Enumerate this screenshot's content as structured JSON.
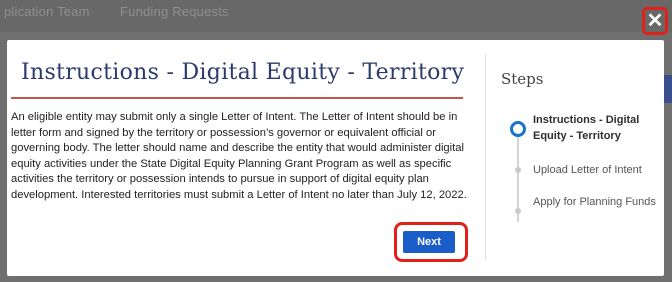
{
  "background": {
    "tabs": [
      "plication Team",
      "Funding Requests"
    ]
  },
  "modal": {
    "title": "Instructions - Digital Equity - Territory",
    "body": "An eligible entity may submit only a single Letter of Intent.  The Letter of Intent should be in letter form and signed by the territory or possession’s governor or equivalent official or governing body.  The letter should name and describe the entity that would administer digital equity activities under the State Digital Equity Planning Grant Program as well as specific activities the territory or possession intends to pursue in support of digital equity plan development. Interested territories must submit a Letter of Intent no later than July 12, 2022.",
    "next_label": "Next",
    "close_glyph": "✕"
  },
  "steps": {
    "title": "Steps",
    "items": [
      {
        "label": "Instructions - Digital Equity - Territory",
        "state": "active"
      },
      {
        "label": "Upload Letter of Intent",
        "state": "pending"
      },
      {
        "label": "Apply for Planning Funds",
        "state": "pending"
      }
    ]
  },
  "colors": {
    "accent": "#1a5dc8",
    "highlight": "#e0201b",
    "title": "#2b3a6b"
  }
}
